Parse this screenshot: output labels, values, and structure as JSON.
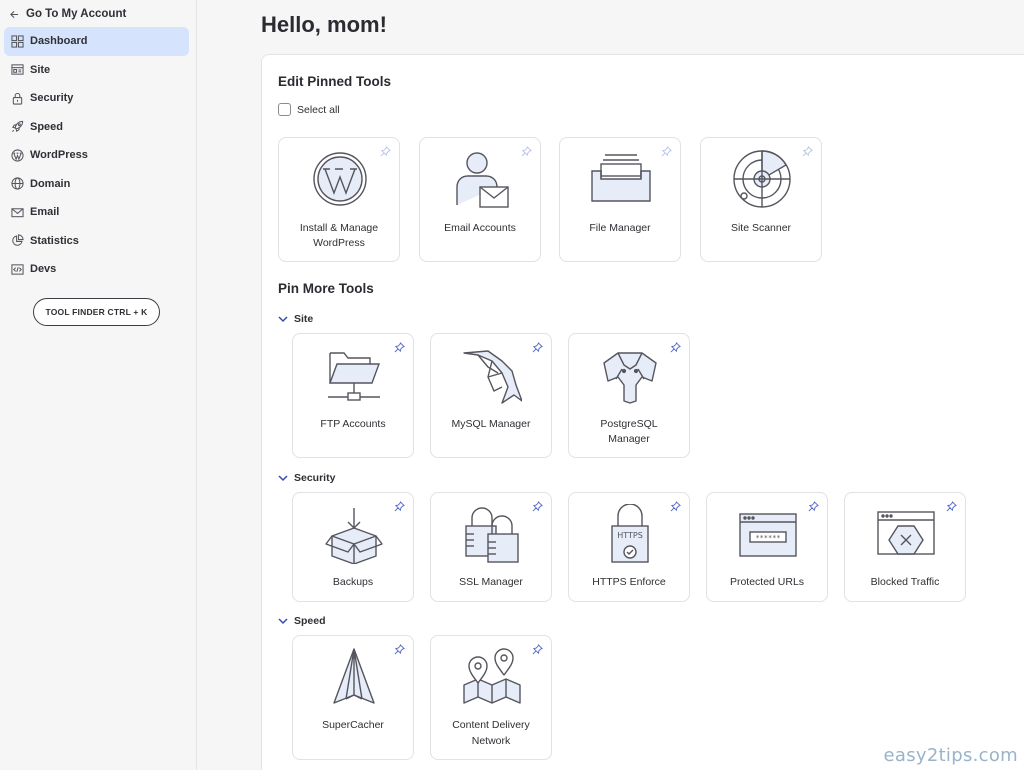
{
  "sidebar": {
    "back_label": "Go To My Account",
    "items": [
      {
        "label": "Dashboard",
        "icon": "dashboard-icon",
        "active": true
      },
      {
        "label": "Site",
        "icon": "site-icon"
      },
      {
        "label": "Security",
        "icon": "lock-icon"
      },
      {
        "label": "Speed",
        "icon": "rocket-icon"
      },
      {
        "label": "WordPress",
        "icon": "wordpress-icon"
      },
      {
        "label": "Domain",
        "icon": "globe-icon"
      },
      {
        "label": "Email",
        "icon": "envelope-icon"
      },
      {
        "label": "Statistics",
        "icon": "pie-chart-icon"
      },
      {
        "label": "Devs",
        "icon": "code-icon"
      }
    ],
    "tool_finder_label": "TOOL FINDER CTRL + K"
  },
  "main": {
    "greeting": "Hello, mom!",
    "pinned": {
      "title": "Edit Pinned Tools",
      "select_all_label": "Select all",
      "tools": [
        {
          "label1": "Install & Manage",
          "label2": "WordPress",
          "icon": "wordpress-icon"
        },
        {
          "label1": "Email Accounts",
          "label2": "",
          "icon": "email-accounts-icon"
        },
        {
          "label1": "File Manager",
          "label2": "",
          "icon": "file-manager-icon"
        },
        {
          "label1": "Site Scanner",
          "label2": "",
          "icon": "radar-icon"
        }
      ]
    },
    "more": {
      "title": "Pin More Tools",
      "groups": {
        "site": {
          "label": "Site",
          "tools": [
            {
              "label1": "FTP Accounts",
              "label2": "",
              "icon": "ftp-folder-icon"
            },
            {
              "label1": "MySQL Manager",
              "label2": "",
              "icon": "dolphin-icon"
            },
            {
              "label1": "PostgreSQL",
              "label2": "Manager",
              "icon": "elephant-icon"
            }
          ]
        },
        "security": {
          "label": "Security",
          "tools": [
            {
              "label1": "Backups",
              "label2": "",
              "icon": "box-icon"
            },
            {
              "label1": "SSL Manager",
              "label2": "",
              "icon": "padlocks-icon"
            },
            {
              "label1": "HTTPS Enforce",
              "label2": "",
              "icon": "https-lock-icon",
              "badge": "HTTPS"
            },
            {
              "label1": "Protected URLs",
              "label2": "",
              "icon": "protected-window-icon",
              "badge": "******"
            },
            {
              "label1": "Blocked Traffic",
              "label2": "",
              "icon": "blocked-window-icon"
            }
          ]
        },
        "speed": {
          "label": "Speed",
          "tools": [
            {
              "label1": "SuperCacher",
              "label2": "",
              "icon": "paper-plane-icon"
            },
            {
              "label1": "Content Delivery",
              "label2": "Network",
              "icon": "map-pins-icon"
            }
          ]
        }
      }
    }
  },
  "watermark": "easy2tips.com",
  "colors": {
    "accent_bg": "#d5e4fc",
    "icon_fill": "#e6edf8",
    "pin": "#5468c9",
    "stroke": "#55555d"
  }
}
